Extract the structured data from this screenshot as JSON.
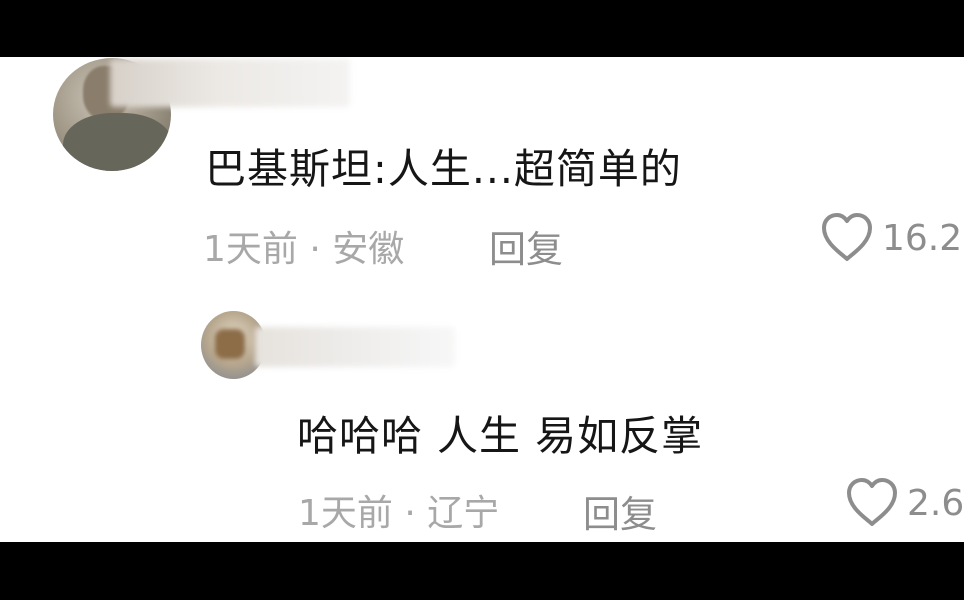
{
  "comments": [
    {
      "text": "巴基斯坦:人生...超简单的",
      "meta": "1天前 · 安徽",
      "reply_label": "回复",
      "likes": "16.2"
    },
    {
      "text": "哈哈哈 人生 易如反掌",
      "meta": "1天前 · 辽宁",
      "reply_label": "回复",
      "likes": "2.6"
    }
  ],
  "icons": {
    "like": "heart-outline-icon"
  },
  "colors": {
    "background": "#ffffff",
    "letterbox": "#000000",
    "comment_text": "#161616",
    "meta_text": "#a8a8a8",
    "action_text": "#8d8d8d"
  }
}
